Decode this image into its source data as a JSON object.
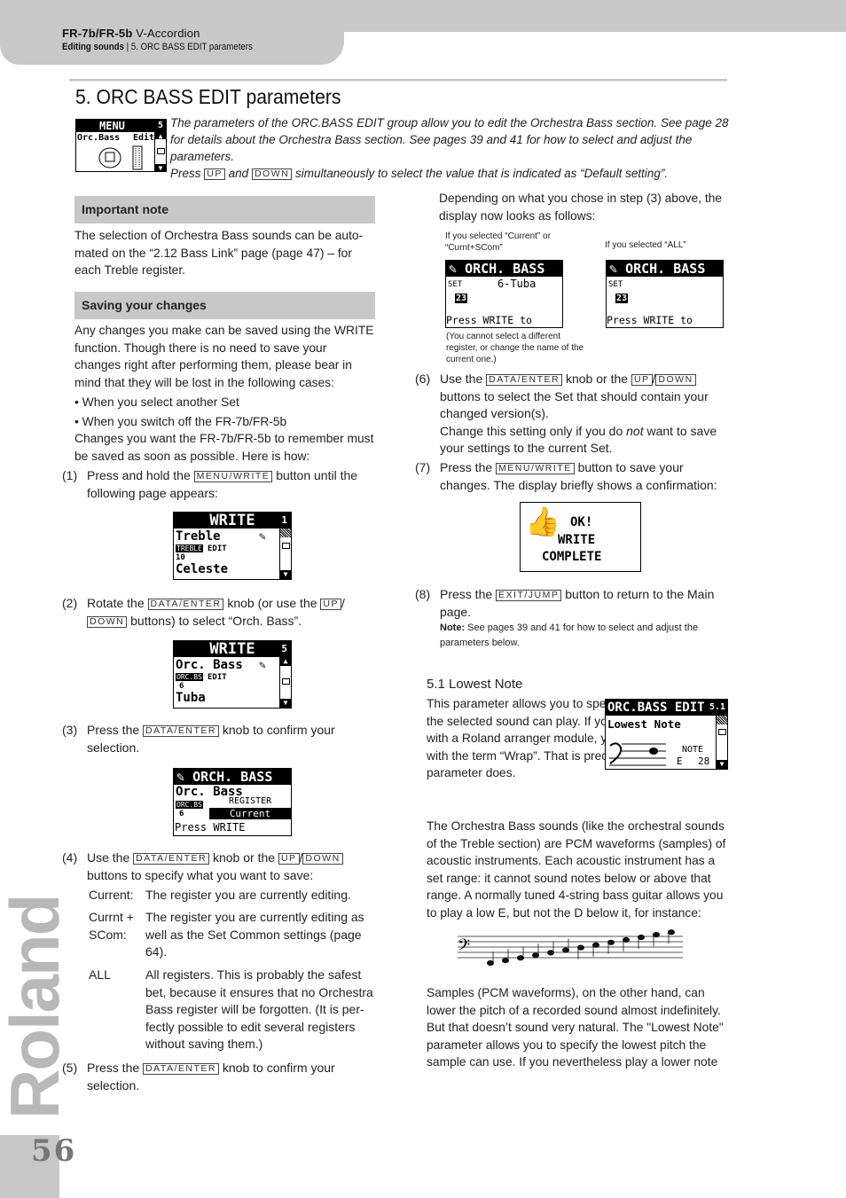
{
  "header": {
    "product": "FR-7b/FR-5b",
    "product_suffix": "V-Accordion",
    "section": "Editing sounds",
    "separator": "|",
    "subsection": "5. ORC BASS EDIT parameters"
  },
  "title": "5. ORC BASS EDIT parameters",
  "intro": {
    "text1": "The parameters of the ORC.BASS EDIT group allow you to edit the Orchestra Bass section. See page 28 for details about the Orchestra Bass section. See pages 39 and 41 for how to select and adjust the parameters.",
    "press": "Press",
    "key_up": "UP",
    "and": "and",
    "key_down": "DOWN",
    "text2": "simultaneously to select the value that is indicated as “Default setting”.",
    "lcd": {
      "title": "MENU",
      "page": "5",
      "line": "Orc.Bass",
      "edit": "Edit"
    }
  },
  "important_note": {
    "heading": "Important note",
    "body": "The selection of Orchestra Bass sounds can be auto-mated on the “2.12 Bass Link” page (page 47) – for each Treble register."
  },
  "saving": {
    "heading": "Saving your changes",
    "body": "Any changes you make can be saved using the WRITE function. Though there is no need to save your changes right after performing them, please bear in mind that they will be lost in the following cases:",
    "bullets": [
      "When you select another Set",
      "When you switch off the FR-7b/FR-5b"
    ],
    "after": "Changes you want the FR-7b/FR-5b to remember must be saved as soon as possible. Here is how:"
  },
  "keys": {
    "menu_write": "MENU/WRITE",
    "data_enter": "DATA/ENTER",
    "up": "UP",
    "down": "DOWN",
    "exit_jump": "EXIT/JUMP"
  },
  "steps": {
    "s1": {
      "num": "(1)",
      "a": "Press and hold the",
      "b": "button until the following page appears:"
    },
    "s2": {
      "num": "(2)",
      "a": "Rotate the",
      "b": "knob (or use the",
      "c": "buttons) to select “Orch. Bass”."
    },
    "s3": {
      "num": "(3)",
      "a": "Press the",
      "b": "knob to confirm your selection."
    },
    "s4": {
      "num": "(4)",
      "a": "Use the",
      "b": "knob or the",
      "c": "buttons to specify what you want to save:",
      "options": [
        {
          "term": "Current:",
          "desc": "The register you are currently editing."
        },
        {
          "term": "Currnt + SCom:",
          "desc": "The register you are currently editing as well as the Set Common settings (page 64)."
        },
        {
          "term": "ALL",
          "desc": "All registers. This is probably the safest bet, because it ensures that no Orchestra Bass register will be forgotten. (It is per-fectly possible to edit several registers without saving them.)"
        }
      ]
    },
    "s5": {
      "num": "(5)",
      "a": "Press the",
      "b": "knob to confirm your selection."
    },
    "s6": {
      "num": "(6)",
      "a": "Use the",
      "b": "knob or the",
      "c": "buttons to select the Set that should contain your changed version(s).",
      "d1": "Change this setting only if you do",
      "d_em": "not",
      "d2": "want to save your settings to the current Set."
    },
    "s7": {
      "num": "(7)",
      "a": "Press the",
      "b": "button to save your changes. The display briefly shows a confirmation:"
    },
    "s8": {
      "num": "(8)",
      "a": "Press the",
      "b": "button to return to the Main page.",
      "note_label": "Note:",
      "note": "See pages 39 and 41 for how to select and adjust the parameters below."
    }
  },
  "lcd_write1": {
    "title": "WRITE",
    "page": "1",
    "line1": "Treble",
    "tag": "TREBLE",
    "num": "10",
    "edit": "EDIT",
    "line2": "Celeste"
  },
  "lcd_write5": {
    "title": "WRITE",
    "page": "5",
    "line1": "Orc. Bass",
    "tag": "ORC.BS",
    "num": "6",
    "edit": "EDIT",
    "line2": "Tuba"
  },
  "lcd_orch_register": {
    "title": "ORCH. BASS",
    "line1": "Orc. Bass",
    "tag": "ORC.BS",
    "num": "6",
    "label": "REGISTER",
    "value": "Current",
    "footer": "Press WRITE"
  },
  "display_now": {
    "intro": "Depending on what you chose in step (3) above, the display now looks as follows:",
    "cap_left": "If you selected “Current” or “Curnt+SCom”",
    "cap_right": "If you selected “ALL”",
    "lcd_left": {
      "title": "ORCH. BASS",
      "set": "SET",
      "value": "23",
      "sound": "6-Tuba",
      "footer": "Press WRITE to Save"
    },
    "lcd_right": {
      "title": "ORCH. BASS",
      "set": "SET",
      "value": "23",
      "footer": "Press WRITE to Save"
    },
    "note_left": "(You cannot select a different register, or change the name of the current one.)"
  },
  "lcd_ok": {
    "l1": "OK!",
    "l2": "WRITE",
    "l3": "COMPLETE"
  },
  "lowest_note": {
    "heading": "5.1 Lowest Note",
    "p1": "This parameter allows you to specify the lowest note the selected sound can play. If you have ever worked with a Roland arranger module, you may be familiar with the term “Wrap”. That is precisely what this parameter does.",
    "p2": "The Orchestra Bass sounds (like the orchestral sounds of the Treble section) are PCM waveforms (samples) of acoustic instruments. Each acoustic instrument has a set range: it cannot sound notes below or above that range. A normally tuned 4-string bass guitar allows you to play a low E, but not the D below it, for instance:",
    "p3": "Samples (PCM waveforms), on the other hand, can lower the pitch of a recorded sound almost indefinitely. But that doesn’t sound very natural. The \"Lowest Note\" parameter allows you to specify the lowest pitch the sample can use. If you nevertheless play a lower note",
    "lcd": {
      "title": "ORC.BASS EDIT",
      "page": "5.1",
      "line": "Lowest Note",
      "label": "NOTE",
      "note": "E",
      "value": "28"
    }
  },
  "footer": {
    "brand": "Roland",
    "page": "56"
  }
}
